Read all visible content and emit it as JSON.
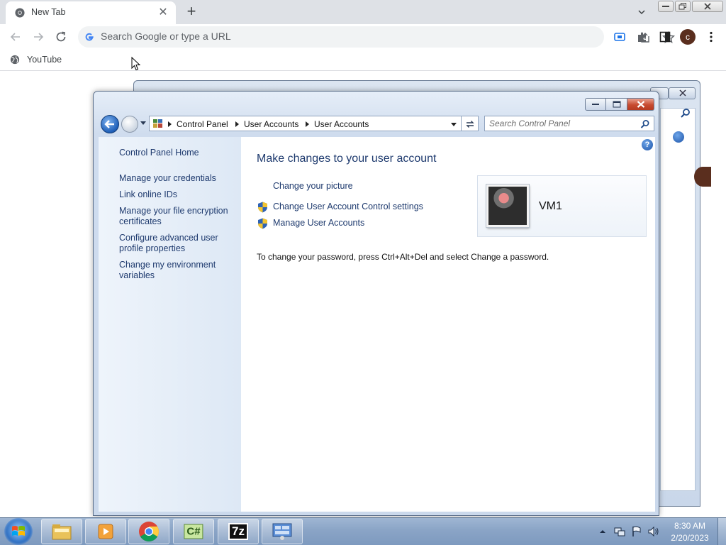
{
  "chrome": {
    "tab_title": "New Tab",
    "omnibox_placeholder": "Search Google or type a URL",
    "profile_initial": "c",
    "bookmarks": [
      {
        "label": "YouTube"
      }
    ]
  },
  "control_panel": {
    "breadcrumb": [
      "Control Panel",
      "User Accounts",
      "User Accounts"
    ],
    "search_placeholder": "Search Control Panel",
    "left_links": [
      "Control Panel Home",
      "Manage your credentials",
      "Link online IDs",
      "Manage your file encryption certificates",
      "Configure advanced user profile properties",
      "Change my environment variables"
    ],
    "heading": "Make changes to your user account",
    "tasks": [
      {
        "label": "Change your picture",
        "shield": false
      },
      {
        "label": "Change User Account Control settings",
        "shield": true
      },
      {
        "label": "Manage User Accounts",
        "shield": true
      }
    ],
    "note": "To change your password, press Ctrl+Alt+Del and select Change a password.",
    "user_name": "VM1",
    "help_glyph": "?"
  },
  "taskbar": {
    "apps": [
      "file-explorer",
      "media-player",
      "chrome",
      "csharp-editor",
      "7-zip",
      "control-panel"
    ],
    "csharp_glyph": "C#",
    "sevenzip_glyph": "7z",
    "clock_time": "8:30 AM",
    "clock_date": "2/20/2023"
  },
  "colors": {
    "link": "#1e3a6e",
    "chrome_tabstrip": "#dee1e6",
    "taskbar": "#8aa4c6"
  }
}
